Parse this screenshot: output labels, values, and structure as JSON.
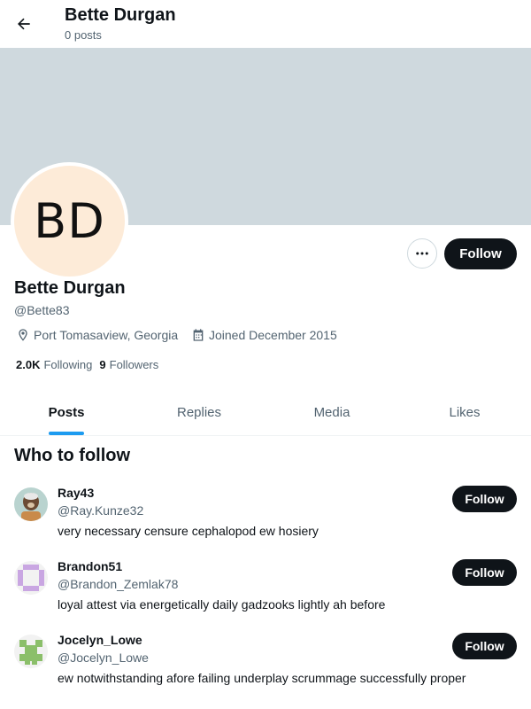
{
  "header": {
    "title": "Bette Durgan",
    "post_count": "0 posts",
    "back_icon": "arrow-left-icon"
  },
  "colors": {
    "banner": "#cfd9de",
    "avatar_bg": "#fdebd8",
    "accent": "#1d9bf0",
    "button": "#0f1419"
  },
  "profile": {
    "initials": "BD",
    "name": "Bette Durgan",
    "handle": "@Bette83",
    "location": "Port Tomasaview, Georgia",
    "joined": "Joined December 2015",
    "following_count": "2.0K",
    "following_label": "Following",
    "followers_count": "9",
    "followers_label": "Followers",
    "follow_label": "Follow",
    "more_icon": "more-horizontal-icon"
  },
  "tabs": [
    {
      "label": "Posts",
      "active": true
    },
    {
      "label": "Replies",
      "active": false
    },
    {
      "label": "Media",
      "active": false
    },
    {
      "label": "Likes",
      "active": false
    }
  ],
  "who_to_follow": {
    "title": "Who to follow",
    "items": [
      {
        "name": "Ray43",
        "handle": "@Ray.Kunze32",
        "bio": "very necessary censure cephalopod ew hosiery",
        "follow_label": "Follow"
      },
      {
        "name": "Brandon51",
        "handle": "@Brandon_Zemlak78",
        "bio": "loyal attest via energetically daily gadzooks lightly ah before",
        "follow_label": "Follow"
      },
      {
        "name": "Jocelyn_Lowe",
        "handle": "@Jocelyn_Lowe",
        "bio": "ew notwithstanding afore failing underplay scrummage successfully proper",
        "follow_label": "Follow"
      }
    ]
  }
}
